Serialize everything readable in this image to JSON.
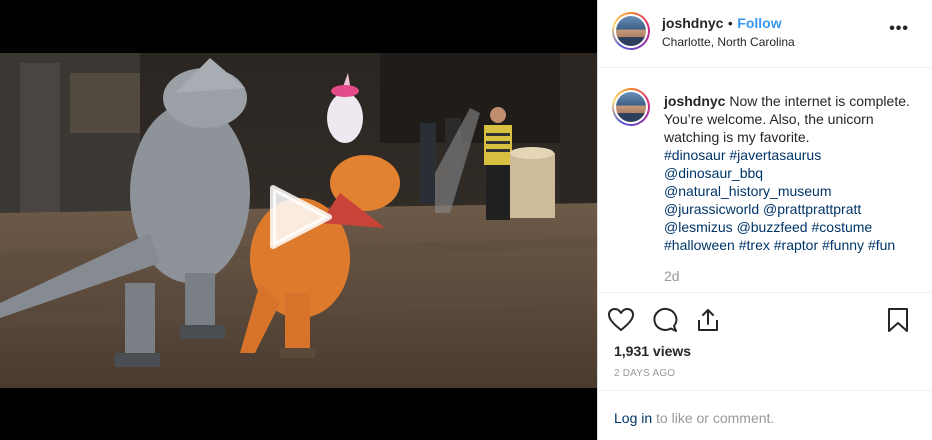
{
  "post": {
    "username": "joshdnyc",
    "separator": "•",
    "follow_label": "Follow",
    "location": "Charlotte, North Carolina",
    "more_label": "•••",
    "caption_text": "Now the internet is complete. You’re welcome. Also, the unicorn watching is my favorite.",
    "hashtags": [
      "#dinosaur",
      "#javertasaurus",
      "@dinosaur_bbq",
      "@natural_history_museum",
      "@jurassicworld",
      "@prattprattpratt",
      "@lesmizus",
      "@buzzfeed",
      "#costume",
      "#halloween",
      "#trex",
      "#raptor",
      "#funny",
      "#fun"
    ],
    "time_ago": "2d",
    "views": "1,931 views",
    "date": "2 DAYS AGO",
    "login_link": "Log in",
    "login_rest": " to like or comment."
  },
  "icons": {
    "like": "heart-icon",
    "comment": "comment-icon",
    "share": "share-icon",
    "save": "bookmark-icon",
    "play": "play-icon"
  },
  "colors": {
    "link_blue": "#3897f0",
    "hashtag": "#003569",
    "muted": "#999999",
    "text": "#262626"
  }
}
